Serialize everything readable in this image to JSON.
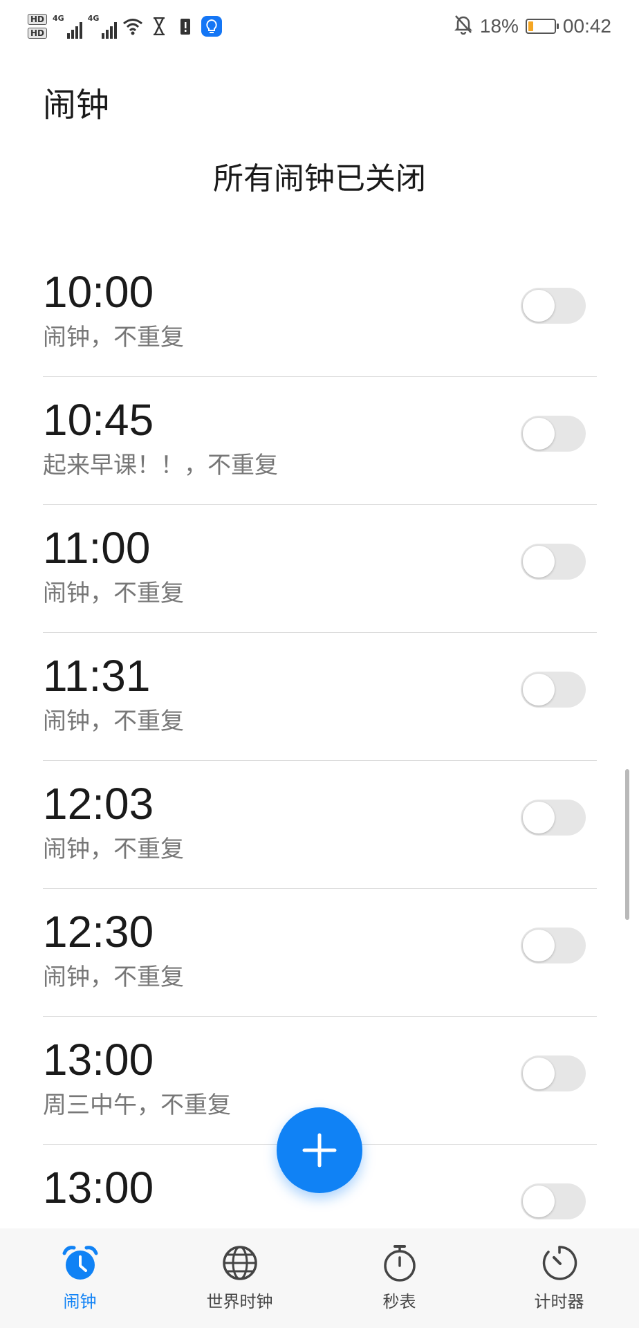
{
  "status_bar": {
    "hd1": "HD",
    "hd2": "HD",
    "net1": "4G",
    "net2": "4G",
    "battery_percent": "18%",
    "time": "00:42",
    "icons": [
      "hd-icon",
      "signal-icon",
      "wifi-icon",
      "hourglass-icon",
      "alert-icon",
      "lightbulb-icon",
      "bell-off-icon",
      "battery-icon"
    ]
  },
  "header": {
    "title": "闹钟",
    "summary": "所有闹钟已关闭"
  },
  "alarms": [
    {
      "time": "10:00",
      "label": "闹钟，不重复",
      "enabled": false
    },
    {
      "time": "10:45",
      "label": "起来早课！！，不重复",
      "enabled": false
    },
    {
      "time": "11:00",
      "label": "闹钟，不重复",
      "enabled": false
    },
    {
      "time": "11:31",
      "label": "闹钟，不重复",
      "enabled": false
    },
    {
      "time": "12:03",
      "label": "闹钟，不重复",
      "enabled": false
    },
    {
      "time": "12:30",
      "label": "闹钟，不重复",
      "enabled": false
    },
    {
      "time": "13:00",
      "label": "周三中午，不重复",
      "enabled": false
    },
    {
      "time": "13:00",
      "label": "",
      "enabled": false
    }
  ],
  "fab": {
    "icon": "plus-icon"
  },
  "bottom_nav": {
    "items": [
      {
        "label": "闹钟",
        "icon": "alarm-clock-icon",
        "active": true
      },
      {
        "label": "世界时钟",
        "icon": "globe-icon",
        "active": false
      },
      {
        "label": "秒表",
        "icon": "stopwatch-icon",
        "active": false
      },
      {
        "label": "计时器",
        "icon": "timer-icon",
        "active": false
      }
    ]
  },
  "colors": {
    "accent": "#1082f5",
    "toggle_off": "#e6e6e6",
    "secondary_text": "#777777"
  }
}
